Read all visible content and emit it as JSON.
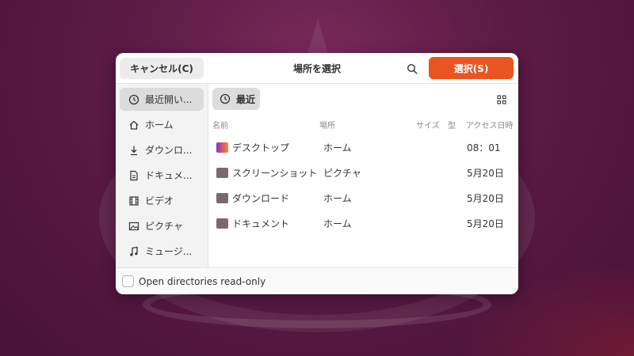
{
  "header": {
    "cancel_label": "キャンセル(C)",
    "title": "場所を選択",
    "select_label": "選択(S)",
    "accent_color": "#e95420"
  },
  "sidebar": {
    "items": [
      {
        "label": "最近開い...",
        "icon": "clock-icon",
        "active": true
      },
      {
        "label": "ホーム",
        "icon": "home-icon"
      },
      {
        "label": "ダウンロ...",
        "icon": "download-icon"
      },
      {
        "label": "ドキュメ...",
        "icon": "document-icon"
      },
      {
        "label": "ビデオ",
        "icon": "film-icon"
      },
      {
        "label": "ピクチャ",
        "icon": "picture-icon"
      },
      {
        "label": "ミュージ...",
        "icon": "music-icon"
      }
    ]
  },
  "main": {
    "recent_label": "最近",
    "columns": [
      "名前",
      "場所",
      "サイズ",
      "型",
      "アクセス日時"
    ],
    "rows": [
      {
        "name": "デスクトップ",
        "location": "ホーム",
        "size": "",
        "type": "",
        "accessed": "08：01",
        "icon": "desktop-folder-icon"
      },
      {
        "name": "スクリーンショット",
        "location": "ピクチャ",
        "size": "",
        "type": "",
        "accessed": "5月20日",
        "icon": "folder-icon"
      },
      {
        "name": "ダウンロード",
        "location": "ホーム",
        "size": "",
        "type": "",
        "accessed": "5月20日",
        "icon": "download-folder-icon"
      },
      {
        "name": "ドキュメント",
        "location": "ホーム",
        "size": "",
        "type": "",
        "accessed": "5月20日",
        "icon": "document-folder-icon"
      }
    ]
  },
  "footer": {
    "read_only_label": "Open directories read-only"
  }
}
